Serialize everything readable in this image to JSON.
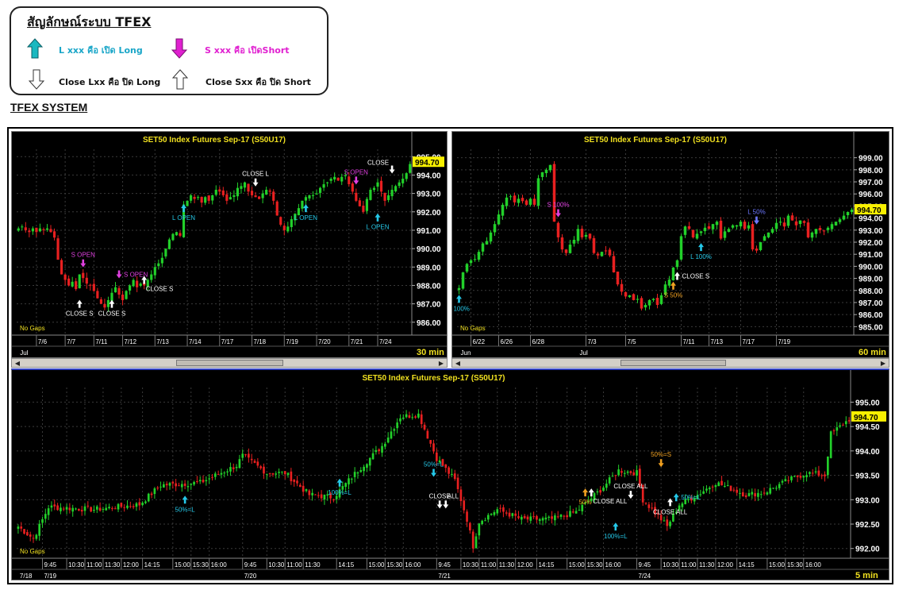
{
  "legend": {
    "title": "สัญลักษณ์ระบบ TFEX",
    "items": [
      {
        "text": "L xxx คือ เปิด Long",
        "color": "#1aa6c8",
        "icon": "teal-up-arrow"
      },
      {
        "text": "S xxx คือ เปิดShort",
        "color": "#e020d0",
        "icon": "magenta-down-arrow"
      },
      {
        "text": "Close Lxx คือ ปิด Long",
        "color": "#111111",
        "icon": "white-down-arrow"
      },
      {
        "text": "Close Sxx คือ ปิด Short",
        "color": "#111111",
        "icon": "white-up-arrow"
      }
    ]
  },
  "system_title": "TFEX SYSTEM",
  "colors": {
    "up": "#22d02a",
    "down": "#e82020",
    "title": "#f0e020",
    "price_tag": "#f8f000",
    "grid": "#3a3a3a",
    "teal": "#25c8e8",
    "magenta": "#e040e0",
    "orange": "#f0a020",
    "white": "#ffffff",
    "blue": "#6d78ff"
  },
  "chart_data": [
    {
      "type": "candlestick",
      "title": "SET50  Index  Futures  Sep-17  (S50U17)",
      "timeframe": "30  min",
      "last_price": "994.70",
      "no_gaps": "No  Gaps",
      "ylim": [
        985.3,
        995.4
      ],
      "y_ticks": [
        "995.00",
        "994.00",
        "993.00",
        "992.00",
        "991.00",
        "990.00",
        "989.00",
        "988.00",
        "987.00",
        "986.00"
      ],
      "y_tick_values": [
        995,
        994,
        993,
        992,
        991,
        990,
        989,
        988,
        987,
        986
      ],
      "x_ticks": [
        "7/6",
        "7/7",
        "7/11",
        "7/12",
        "7/13",
        "7/14",
        "7/17",
        "7/18",
        "7/19",
        "7/20",
        "7/21",
        "7/24"
      ],
      "x_tick_bar": [
        5,
        13,
        21,
        29,
        38,
        47,
        56,
        65,
        74,
        83,
        92,
        100
      ],
      "month_label": "Jul",
      "bars": 110,
      "closes": [
        991.1,
        991.2,
        991.0,
        990.9,
        991.1,
        990.9,
        991.1,
        991.0,
        991.1,
        990.9,
        990.6,
        989.4,
        988.6,
        988.3,
        988.0,
        988.2,
        987.8,
        988.6,
        988.4,
        988.1,
        988.0,
        987.7,
        987.3,
        987.0,
        986.8,
        987.2,
        987.6,
        987.9,
        987.5,
        987.2,
        987.7,
        988.0,
        988.3,
        987.9,
        988.1,
        988.0,
        988.3,
        988.6,
        989.0,
        989.2,
        989.5,
        990.0,
        990.5,
        990.8,
        990.9,
        990.7,
        992.4,
        992.6,
        992.9,
        992.7,
        992.8,
        992.5,
        992.8,
        992.6,
        992.9,
        993.2,
        993.1,
        992.9,
        992.6,
        992.8,
        992.9,
        993.3,
        993.4,
        993.6,
        993.1,
        992.9,
        992.8,
        992.7,
        993.0,
        993.2,
        993.1,
        992.6,
        991.8,
        991.3,
        991.0,
        991.2,
        991.6,
        991.9,
        992.2,
        992.6,
        992.8,
        992.9,
        992.9,
        993.0,
        993.3,
        993.5,
        993.6,
        993.8,
        993.9,
        993.7,
        993.9,
        994.0,
        993.5,
        993.1,
        992.6,
        992.3,
        992.0,
        992.7,
        993.2,
        993.3,
        993.6,
        993.1,
        992.6,
        992.9,
        993.2,
        993.4,
        993.6,
        993.8,
        994.1,
        994.6
      ],
      "signals": [
        {
          "bar": 18,
          "label": "S  OPEN",
          "color": "magenta",
          "dir": "down",
          "price": 989.2,
          "label_pos": "above"
        },
        {
          "bar": 28,
          "label": "S  OPEN",
          "color": "magenta",
          "dir": "down",
          "price": 988.6,
          "label_pos": "right"
        },
        {
          "bar": 17,
          "label": "CLOSE  S",
          "color": "white",
          "dir": "up",
          "price": 987.0,
          "label_pos": "below"
        },
        {
          "bar": 26,
          "label": "CLOSE  S",
          "color": "white",
          "dir": "up",
          "price": 987.0,
          "label_pos": "below"
        },
        {
          "bar": 35,
          "label": "CLOSE  S",
          "color": "white",
          "dir": "up",
          "price": 988.3,
          "label_pos": "below-right"
        },
        {
          "bar": 46,
          "label": "L  OPEN",
          "color": "teal",
          "dir": "up",
          "price": 992.2,
          "label_pos": "below"
        },
        {
          "bar": 66,
          "label": "CLOSE  L",
          "color": "white",
          "dir": "down",
          "price": 993.6,
          "label_pos": "above"
        },
        {
          "bar": 80,
          "label": "L  OPEN",
          "color": "teal",
          "dir": "up",
          "price": 992.2,
          "label_pos": "below"
        },
        {
          "bar": 94,
          "label": "S  OPEN",
          "color": "magenta",
          "dir": "down",
          "price": 993.7,
          "label_pos": "above"
        },
        {
          "bar": 100,
          "label": "L  OPEN",
          "color": "teal",
          "dir": "up",
          "price": 991.7,
          "label_pos": "below"
        },
        {
          "bar": 104,
          "label": "CLOSE",
          "color": "white",
          "dir": "down",
          "price": 994.3,
          "label_pos": "above-left"
        }
      ]
    },
    {
      "type": "candlestick",
      "title": "SET50  Index  Futures  Sep-17  (S50U17)",
      "timeframe": "60  min",
      "last_price": "994.70",
      "no_gaps": "No  Gaps",
      "ylim": [
        984.3,
        999.7
      ],
      "y_ticks": [
        "999.00",
        "998.00",
        "997.00",
        "996.00",
        "995.00",
        "994.00",
        "993.00",
        "992.00",
        "991.00",
        "990.00",
        "989.00",
        "988.00",
        "987.00",
        "986.00",
        "985.00"
      ],
      "y_tick_values": [
        999,
        998,
        997,
        996,
        995,
        994,
        993,
        992,
        991,
        990,
        989,
        988,
        987,
        986,
        985
      ],
      "x_ticks": [
        "6/22",
        "6/26",
        "6/28",
        "7/3",
        "7/5",
        "7/11",
        "7/13",
        "7/17",
        "7/19"
      ],
      "x_tick_bar": [
        3,
        10,
        18,
        32,
        42,
        56,
        63,
        71,
        80
      ],
      "month_labels": [
        {
          "text": "Jun",
          "bar": 0
        },
        {
          "text": "Jul",
          "bar": 30
        }
      ],
      "bars": 100,
      "closes": [
        988.2,
        989.5,
        990.2,
        990.5,
        990.6,
        991.2,
        991.9,
        992.1,
        992.8,
        993.5,
        994.3,
        995.1,
        995.7,
        995.8,
        995.3,
        995.6,
        995.4,
        995.1,
        995.6,
        995.1,
        997.3,
        997.8,
        998.0,
        998.4,
        993.7,
        992.4,
        991.4,
        991.1,
        991.8,
        992.2,
        993.1,
        992.4,
        992.6,
        992.3,
        991.1,
        990.9,
        991.2,
        991.3,
        990.9,
        989.5,
        988.5,
        987.9,
        987.5,
        987.6,
        987.2,
        987.3,
        986.5,
        986.8,
        987.2,
        987.3,
        986.8,
        987.6,
        988.5,
        988.9,
        989.9,
        990.5,
        992.5,
        993.3,
        993.1,
        992.4,
        992.7,
        992.9,
        993.2,
        993.1,
        993.5,
        993.7,
        992.3,
        992.9,
        993.1,
        993.4,
        993.4,
        993.7,
        993.1,
        993.4,
        991.4,
        991.3,
        992.0,
        992.5,
        992.8,
        993.1,
        993.6,
        993.7,
        993.3,
        994.2,
        993.8,
        993.4,
        993.8,
        993.6,
        992.4,
        992.8,
        993.1,
        993.0,
        992.9,
        993.2,
        993.5,
        993.7,
        993.9,
        994.2,
        994.5,
        994.7
      ],
      "signals": [
        {
          "bar": 0,
          "label": "L  100%",
          "color": "teal",
          "dir": "up",
          "price": 987.3,
          "label_pos": "below"
        },
        {
          "bar": 25,
          "label": "S  100%",
          "color": "magenta",
          "dir": "down",
          "price": 994.4,
          "label_pos": "above"
        },
        {
          "bar": 55,
          "label": "CLOSE  S",
          "color": "white",
          "dir": "up",
          "price": 989.2,
          "label_pos": "right"
        },
        {
          "bar": 54,
          "label": "S  50%",
          "color": "orange",
          "dir": "up",
          "price": 988.4,
          "label_pos": "below"
        },
        {
          "bar": 61,
          "label": "L  100%",
          "color": "teal",
          "dir": "up",
          "price": 991.6,
          "label_pos": "below"
        },
        {
          "bar": 75,
          "label": "L  50%",
          "color": "blue",
          "dir": "down",
          "price": 993.8,
          "label_pos": "above"
        }
      ]
    },
    {
      "type": "candlestick",
      "title": "SET50  Index  Futures  Sep-17  (S50U17)",
      "timeframe": "5  min",
      "last_price": "994.70",
      "no_gaps": "No  Gaps",
      "ylim": [
        991.8,
        995.3
      ],
      "y_ticks": [
        "995.00",
        "994.50",
        "994.00",
        "993.50",
        "993.00",
        "992.50",
        "992.00"
      ],
      "y_tick_values": [
        995.0,
        994.5,
        994.0,
        993.5,
        993.0,
        992.5,
        992.0
      ],
      "x_ticks": [
        "9:45",
        "10:30",
        "11:00",
        "11:30",
        "12:00",
        "14:15",
        "15:00",
        "15:30",
        "16:00",
        "9:45",
        "10:30",
        "11:00",
        "11:30",
        "14:15",
        "15:00",
        "15:30",
        "16:00",
        "9:45",
        "10:30",
        "11:00",
        "11:30",
        "12:00",
        "14:15",
        "15:00",
        "15:30",
        "16:00",
        "9:45",
        "10:30",
        "11:00",
        "11:30",
        "12:00",
        "14:15",
        "15:00",
        "15:30",
        "16:00"
      ],
      "x_tick_bar": [
        8,
        16,
        22,
        28,
        34,
        41,
        51,
        57,
        63,
        74,
        82,
        88,
        94,
        105,
        115,
        121,
        127,
        138,
        146,
        152,
        158,
        164,
        171,
        181,
        187,
        193,
        204,
        212,
        218,
        224,
        230,
        237,
        247,
        253,
        259
      ],
      "date_labels": [
        {
          "text": "7/18",
          "bar": 0
        },
        {
          "text": "7/19",
          "bar": 8
        },
        {
          "text": "7/20",
          "bar": 74
        },
        {
          "text": "7/21",
          "bar": 138
        },
        {
          "text": "7/24",
          "bar": 204
        }
      ],
      "bars": 275,
      "closes": [],
      "signals": [
        {
          "bar": 55,
          "label": "50%=L",
          "color": "teal",
          "dir": "up",
          "price": 993.0,
          "label_pos": "below"
        },
        {
          "bar": 106,
          "label": "100%=L",
          "color": "teal",
          "dir": "up",
          "price": 993.35,
          "label_pos": "below"
        },
        {
          "bar": 137,
          "label": "50%=L",
          "color": "teal",
          "dir": "down",
          "price": 993.55,
          "label_pos": "above"
        },
        {
          "bar": 139,
          "label": "CLOSE",
          "color": "white",
          "dir": "down",
          "price": 992.9,
          "label_pos": "above"
        },
        {
          "bar": 141,
          "label": "ALL",
          "color": "white",
          "dir": "down",
          "price": 992.9,
          "label_pos": "above-right"
        },
        {
          "bar": 187,
          "label": "50%",
          "color": "orange",
          "dir": "up",
          "price": 993.15,
          "label_pos": "below"
        },
        {
          "bar": 189,
          "label": "CLOSE  ALL",
          "color": "white",
          "dir": "up",
          "price": 993.15,
          "label_pos": "below-right"
        },
        {
          "bar": 197,
          "label": "100%=L",
          "color": "teal",
          "dir": "up",
          "price": 992.45,
          "label_pos": "below"
        },
        {
          "bar": 202,
          "label": "CLOSE  ALL",
          "color": "white",
          "dir": "down",
          "price": 993.1,
          "label_pos": "above"
        },
        {
          "bar": 212,
          "label": "50%=S",
          "color": "orange",
          "dir": "down",
          "price": 993.75,
          "label_pos": "above"
        },
        {
          "bar": 217,
          "label": "50%=L",
          "color": "teal",
          "dir": "up",
          "price": 993.05,
          "label_pos": "right"
        },
        {
          "bar": 215,
          "label": "CLOSE  ALL",
          "color": "white",
          "dir": "up",
          "price": 992.95,
          "label_pos": "below"
        }
      ]
    }
  ]
}
